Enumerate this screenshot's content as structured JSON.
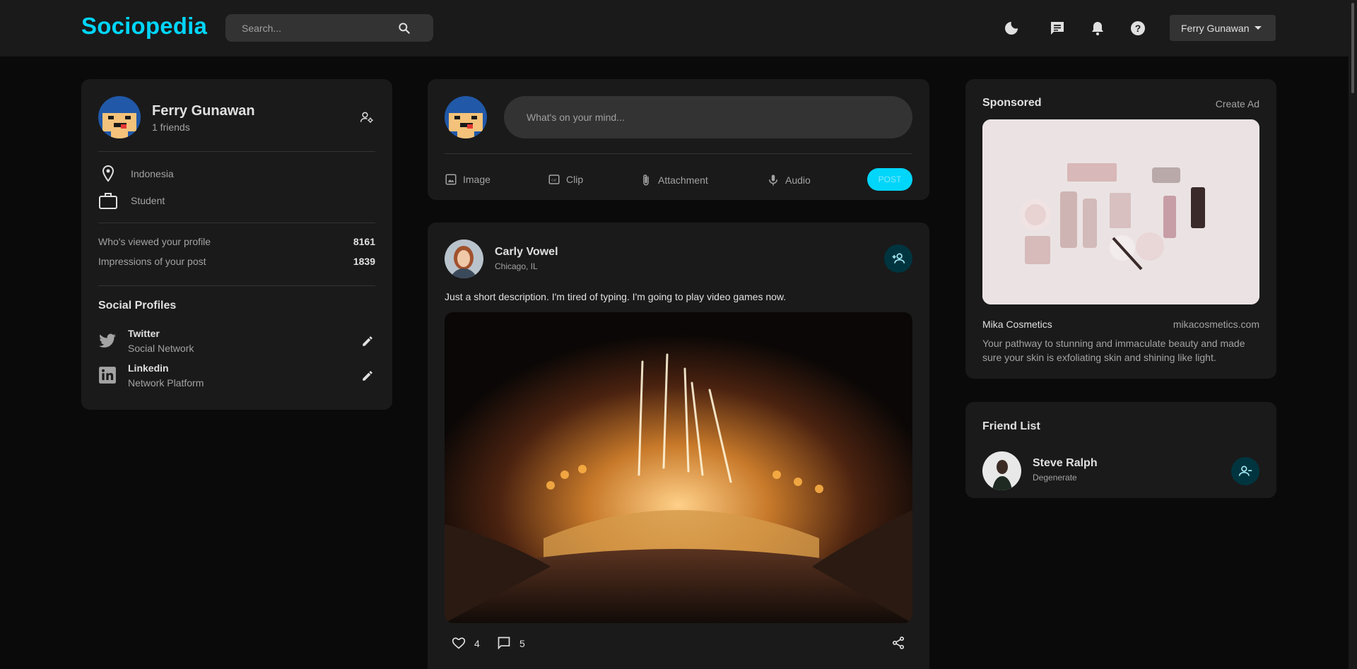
{
  "app": {
    "logo": "Sociopedia"
  },
  "search": {
    "placeholder": "Search..."
  },
  "nav": {
    "user_name": "Ferry Gunawan"
  },
  "profile": {
    "name": "Ferry Gunawan",
    "friends": "1 friends",
    "location": "Indonesia",
    "occupation": "Student",
    "stats": [
      {
        "label": "Who's viewed your profile",
        "value": "8161"
      },
      {
        "label": "Impressions of your post",
        "value": "1839"
      }
    ],
    "social_title": "Social Profiles",
    "socials": [
      {
        "name": "Twitter",
        "type": "Social Network",
        "icon": "twitter-icon"
      },
      {
        "name": "Linkedin",
        "type": "Network Platform",
        "icon": "linkedin-icon"
      }
    ]
  },
  "composer": {
    "placeholder": "What's on your mind...",
    "tools": [
      "Image",
      "Clip",
      "Attachment",
      "Audio"
    ],
    "post_label": "POST"
  },
  "post": {
    "author": "Carly Vowel",
    "location": "Chicago, IL",
    "text": "Just a short description. I'm tired of typing. I'm going to play video games now.",
    "likes": "4",
    "comments": "5"
  },
  "sponsored": {
    "title": "Sponsored",
    "create_ad": "Create Ad",
    "brand": "Mika Cosmetics",
    "url": "mikacosmetics.com",
    "description": "Your pathway to stunning and immaculate beauty and made sure your skin is exfoliating skin and shining like light."
  },
  "friends": {
    "title": "Friend List",
    "items": [
      {
        "name": "Steve Ralph",
        "subtitle": "Degenerate"
      }
    ]
  },
  "colors": {
    "accent": "#00d5fa",
    "card": "#1a1a1a",
    "background": "#0a0a0a"
  }
}
